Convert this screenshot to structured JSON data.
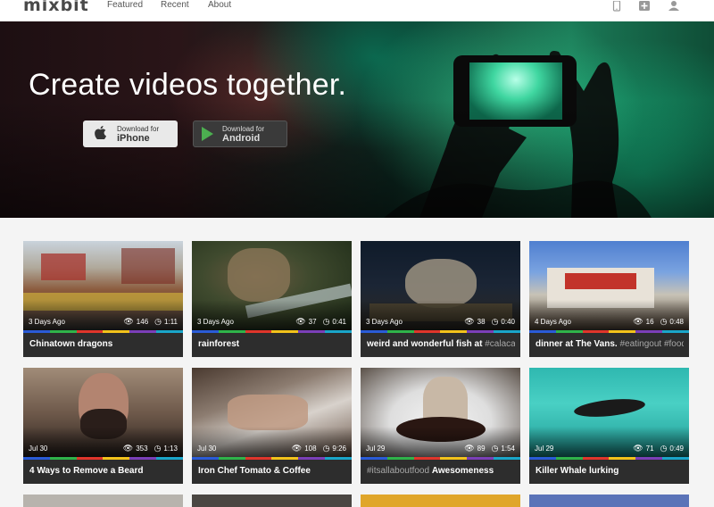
{
  "nav": {
    "logo": "mixbit",
    "links": [
      "Featured",
      "Recent",
      "About"
    ]
  },
  "hero": {
    "title": "Create videos together.",
    "ios": {
      "small": "Download for",
      "big": "iPhone"
    },
    "android": {
      "small": "Download for",
      "big": "Android"
    }
  },
  "colors": {
    "stripe": [
      "#2a5bd7",
      "#2fb34a",
      "#e0352b",
      "#f2c21b",
      "#7b3fb8",
      "#1aa5c9"
    ]
  },
  "videos": [
    {
      "date": "3 Days Ago",
      "views": "146",
      "duration": "1:11",
      "title": "Chinatown dragons",
      "tags": ""
    },
    {
      "date": "3 Days Ago",
      "views": "37",
      "duration": "0:41",
      "title": "rainforest",
      "tags": ""
    },
    {
      "date": "3 Days Ago",
      "views": "38",
      "duration": "0:40",
      "title": "weird and wonderful fish at",
      "tags": " #calaca..."
    },
    {
      "date": "4 Days Ago",
      "views": "16",
      "duration": "0:48",
      "title": "dinner at The Vans.",
      "tags": " #eatingout #food"
    },
    {
      "date": "Jul 30",
      "views": "353",
      "duration": "1:13",
      "title": "4 Ways to Remove a Beard",
      "tags": ""
    },
    {
      "date": "Jul 30",
      "views": "108",
      "duration": "9:26",
      "title": "Iron Chef Tomato & Coffee",
      "tags": ""
    },
    {
      "date": "Jul 29",
      "views": "89",
      "duration": "1:54",
      "title": "Awesomeness",
      "tags": "#itsallaboutfood "
    },
    {
      "date": "Jul 29",
      "views": "71",
      "duration": "0:49",
      "title": "Killer Whale lurking",
      "tags": ""
    }
  ]
}
